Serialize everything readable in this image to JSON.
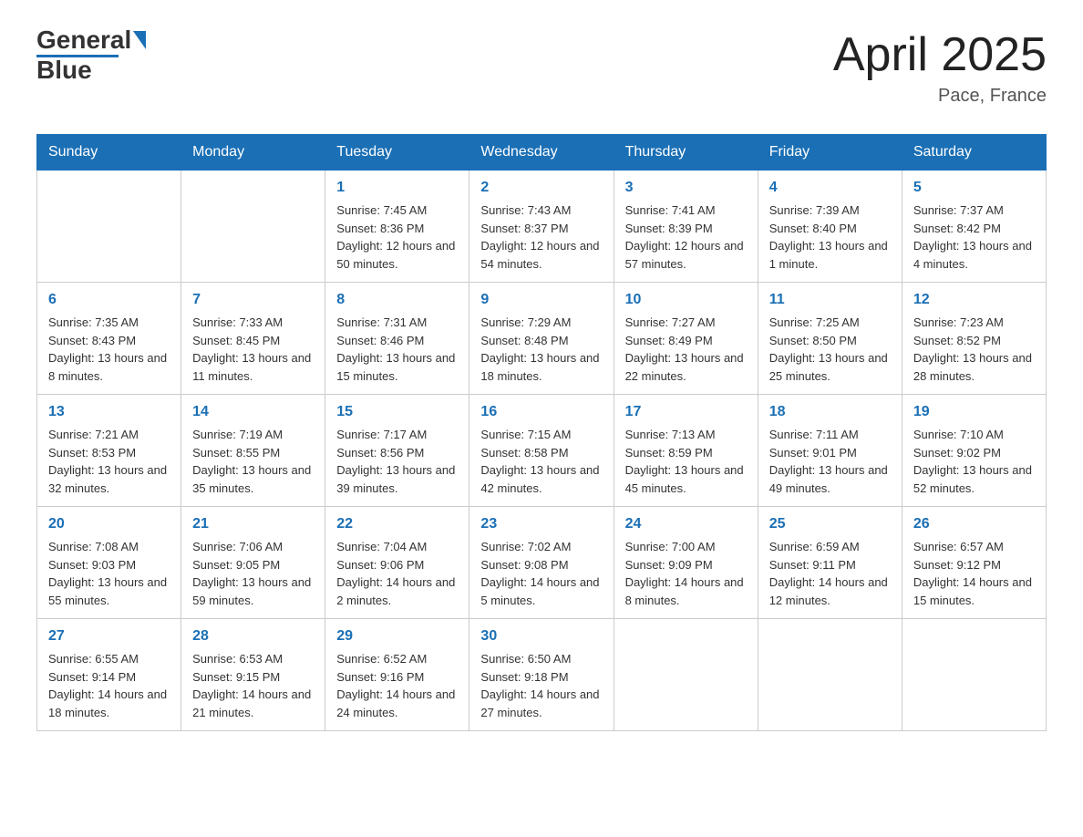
{
  "header": {
    "logo_text_general": "General",
    "logo_text_blue": "Blue",
    "month_title": "April 2025",
    "location": "Pace, France"
  },
  "weekdays": [
    "Sunday",
    "Monday",
    "Tuesday",
    "Wednesday",
    "Thursday",
    "Friday",
    "Saturday"
  ],
  "weeks": [
    [
      {
        "day": "",
        "sunrise": "",
        "sunset": "",
        "daylight": ""
      },
      {
        "day": "",
        "sunrise": "",
        "sunset": "",
        "daylight": ""
      },
      {
        "day": "1",
        "sunrise": "Sunrise: 7:45 AM",
        "sunset": "Sunset: 8:36 PM",
        "daylight": "Daylight: 12 hours and 50 minutes."
      },
      {
        "day": "2",
        "sunrise": "Sunrise: 7:43 AM",
        "sunset": "Sunset: 8:37 PM",
        "daylight": "Daylight: 12 hours and 54 minutes."
      },
      {
        "day": "3",
        "sunrise": "Sunrise: 7:41 AM",
        "sunset": "Sunset: 8:39 PM",
        "daylight": "Daylight: 12 hours and 57 minutes."
      },
      {
        "day": "4",
        "sunrise": "Sunrise: 7:39 AM",
        "sunset": "Sunset: 8:40 PM",
        "daylight": "Daylight: 13 hours and 1 minute."
      },
      {
        "day": "5",
        "sunrise": "Sunrise: 7:37 AM",
        "sunset": "Sunset: 8:42 PM",
        "daylight": "Daylight: 13 hours and 4 minutes."
      }
    ],
    [
      {
        "day": "6",
        "sunrise": "Sunrise: 7:35 AM",
        "sunset": "Sunset: 8:43 PM",
        "daylight": "Daylight: 13 hours and 8 minutes."
      },
      {
        "day": "7",
        "sunrise": "Sunrise: 7:33 AM",
        "sunset": "Sunset: 8:45 PM",
        "daylight": "Daylight: 13 hours and 11 minutes."
      },
      {
        "day": "8",
        "sunrise": "Sunrise: 7:31 AM",
        "sunset": "Sunset: 8:46 PM",
        "daylight": "Daylight: 13 hours and 15 minutes."
      },
      {
        "day": "9",
        "sunrise": "Sunrise: 7:29 AM",
        "sunset": "Sunset: 8:48 PM",
        "daylight": "Daylight: 13 hours and 18 minutes."
      },
      {
        "day": "10",
        "sunrise": "Sunrise: 7:27 AM",
        "sunset": "Sunset: 8:49 PM",
        "daylight": "Daylight: 13 hours and 22 minutes."
      },
      {
        "day": "11",
        "sunrise": "Sunrise: 7:25 AM",
        "sunset": "Sunset: 8:50 PM",
        "daylight": "Daylight: 13 hours and 25 minutes."
      },
      {
        "day": "12",
        "sunrise": "Sunrise: 7:23 AM",
        "sunset": "Sunset: 8:52 PM",
        "daylight": "Daylight: 13 hours and 28 minutes."
      }
    ],
    [
      {
        "day": "13",
        "sunrise": "Sunrise: 7:21 AM",
        "sunset": "Sunset: 8:53 PM",
        "daylight": "Daylight: 13 hours and 32 minutes."
      },
      {
        "day": "14",
        "sunrise": "Sunrise: 7:19 AM",
        "sunset": "Sunset: 8:55 PM",
        "daylight": "Daylight: 13 hours and 35 minutes."
      },
      {
        "day": "15",
        "sunrise": "Sunrise: 7:17 AM",
        "sunset": "Sunset: 8:56 PM",
        "daylight": "Daylight: 13 hours and 39 minutes."
      },
      {
        "day": "16",
        "sunrise": "Sunrise: 7:15 AM",
        "sunset": "Sunset: 8:58 PM",
        "daylight": "Daylight: 13 hours and 42 minutes."
      },
      {
        "day": "17",
        "sunrise": "Sunrise: 7:13 AM",
        "sunset": "Sunset: 8:59 PM",
        "daylight": "Daylight: 13 hours and 45 minutes."
      },
      {
        "day": "18",
        "sunrise": "Sunrise: 7:11 AM",
        "sunset": "Sunset: 9:01 PM",
        "daylight": "Daylight: 13 hours and 49 minutes."
      },
      {
        "day": "19",
        "sunrise": "Sunrise: 7:10 AM",
        "sunset": "Sunset: 9:02 PM",
        "daylight": "Daylight: 13 hours and 52 minutes."
      }
    ],
    [
      {
        "day": "20",
        "sunrise": "Sunrise: 7:08 AM",
        "sunset": "Sunset: 9:03 PM",
        "daylight": "Daylight: 13 hours and 55 minutes."
      },
      {
        "day": "21",
        "sunrise": "Sunrise: 7:06 AM",
        "sunset": "Sunset: 9:05 PM",
        "daylight": "Daylight: 13 hours and 59 minutes."
      },
      {
        "day": "22",
        "sunrise": "Sunrise: 7:04 AM",
        "sunset": "Sunset: 9:06 PM",
        "daylight": "Daylight: 14 hours and 2 minutes."
      },
      {
        "day": "23",
        "sunrise": "Sunrise: 7:02 AM",
        "sunset": "Sunset: 9:08 PM",
        "daylight": "Daylight: 14 hours and 5 minutes."
      },
      {
        "day": "24",
        "sunrise": "Sunrise: 7:00 AM",
        "sunset": "Sunset: 9:09 PM",
        "daylight": "Daylight: 14 hours and 8 minutes."
      },
      {
        "day": "25",
        "sunrise": "Sunrise: 6:59 AM",
        "sunset": "Sunset: 9:11 PM",
        "daylight": "Daylight: 14 hours and 12 minutes."
      },
      {
        "day": "26",
        "sunrise": "Sunrise: 6:57 AM",
        "sunset": "Sunset: 9:12 PM",
        "daylight": "Daylight: 14 hours and 15 minutes."
      }
    ],
    [
      {
        "day": "27",
        "sunrise": "Sunrise: 6:55 AM",
        "sunset": "Sunset: 9:14 PM",
        "daylight": "Daylight: 14 hours and 18 minutes."
      },
      {
        "day": "28",
        "sunrise": "Sunrise: 6:53 AM",
        "sunset": "Sunset: 9:15 PM",
        "daylight": "Daylight: 14 hours and 21 minutes."
      },
      {
        "day": "29",
        "sunrise": "Sunrise: 6:52 AM",
        "sunset": "Sunset: 9:16 PM",
        "daylight": "Daylight: 14 hours and 24 minutes."
      },
      {
        "day": "30",
        "sunrise": "Sunrise: 6:50 AM",
        "sunset": "Sunset: 9:18 PM",
        "daylight": "Daylight: 14 hours and 27 minutes."
      },
      {
        "day": "",
        "sunrise": "",
        "sunset": "",
        "daylight": ""
      },
      {
        "day": "",
        "sunrise": "",
        "sunset": "",
        "daylight": ""
      },
      {
        "day": "",
        "sunrise": "",
        "sunset": "",
        "daylight": ""
      }
    ]
  ]
}
